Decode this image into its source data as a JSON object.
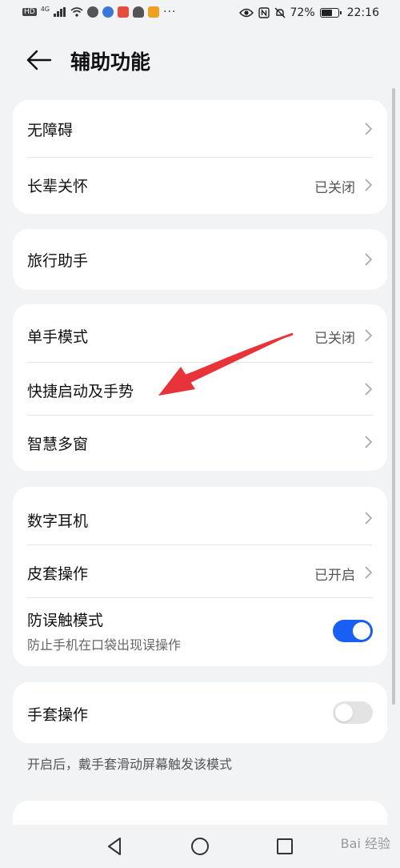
{
  "status_bar": {
    "left_labels": [
      "HD",
      "4G"
    ],
    "battery_percent": "72%",
    "time": "22:16"
  },
  "header": {
    "title": "辅助功能"
  },
  "sections": {
    "s1": {
      "accessibility": "无障碍",
      "elderly_care": "长辈关怀",
      "elderly_care_value": "已关闭"
    },
    "s2": {
      "travel_assistant": "旅行助手"
    },
    "s3": {
      "one_hand": "单手模式",
      "one_hand_value": "已关闭",
      "shortcuts": "快捷启动及手势",
      "smart_multiwindow": "智慧多窗"
    },
    "s4": {
      "digital_earphone": "数字耳机",
      "cover_operation": "皮套操作",
      "cover_operation_value": "已开启",
      "accidental_touch": "防误触模式",
      "accidental_touch_desc": "防止手机在口袋出现误操作",
      "accidental_touch_on": true
    },
    "s5": {
      "glove_mode": "手套操作",
      "glove_mode_on": false
    }
  },
  "glove_note": "开启后，戴手套滑动屏幕触发该模式",
  "watermark": "Bai 经验",
  "colors": {
    "accent": "#1a5ff5",
    "annotation_arrow": "#e8333a",
    "background": "#f1f3f5"
  },
  "icons": [
    "back-arrow-icon",
    "chevron-right-icon",
    "nav-back-icon",
    "nav-home-icon",
    "nav-recents-icon",
    "battery-icon",
    "wifi-icon",
    "signal-icon"
  ]
}
